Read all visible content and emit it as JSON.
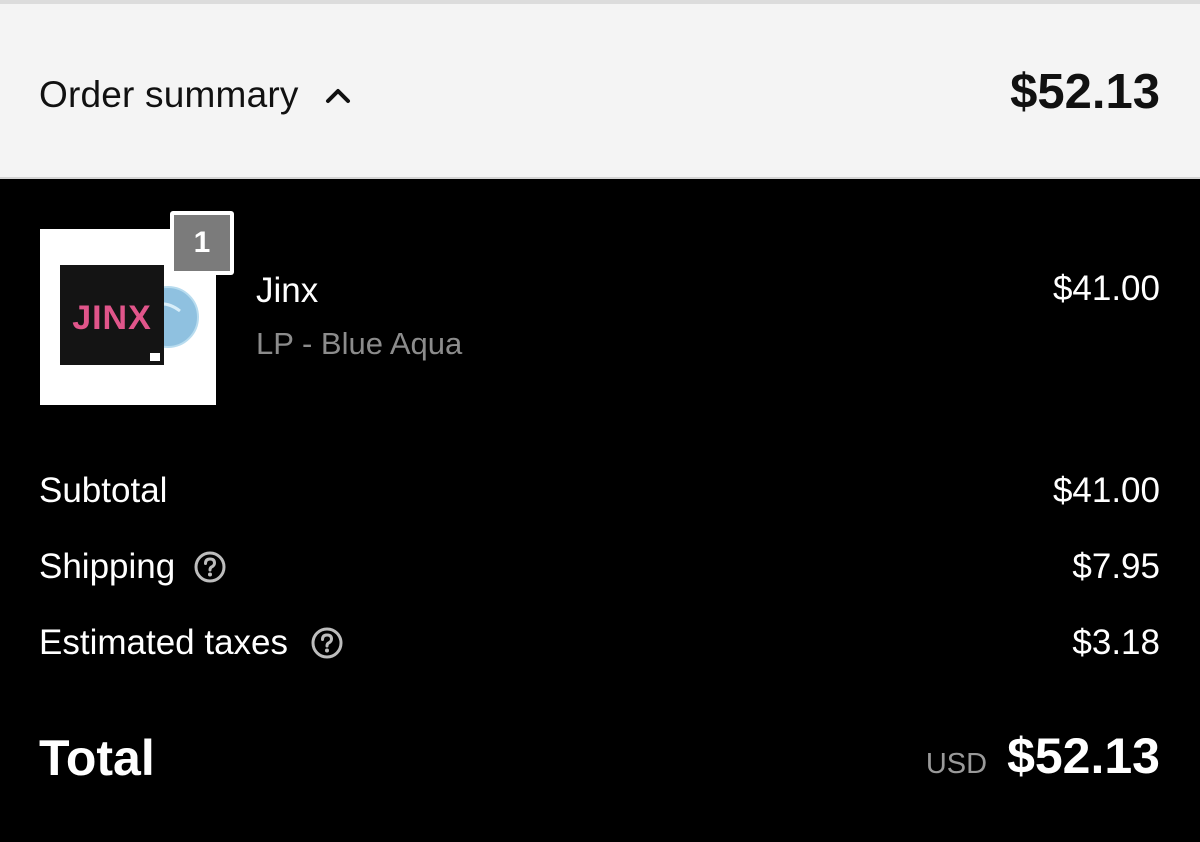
{
  "header": {
    "label": "Order summary",
    "toggle_icon": "chevron-up-icon",
    "total": "$52.13"
  },
  "line_item": {
    "quantity": "1",
    "name": "Jinx",
    "variant": "LP - Blue Aqua",
    "price": "$41.00",
    "thumbnail_text": "JINX"
  },
  "summary": {
    "subtotal_label": "Subtotal",
    "subtotal_value": "$41.00",
    "shipping_label": "Shipping",
    "shipping_value": "$7.95",
    "taxes_label": "Estimated taxes",
    "taxes_value": "$3.18",
    "help_icon": "question-circle-icon"
  },
  "total": {
    "label": "Total",
    "currency": "USD",
    "amount": "$52.13"
  },
  "colors": {
    "background": "#000000",
    "header_background": "#f4f4f4",
    "muted_text": "#8c8c8c",
    "badge": "#7b7b7b",
    "vinyl_blue": "#8fc1e0"
  }
}
